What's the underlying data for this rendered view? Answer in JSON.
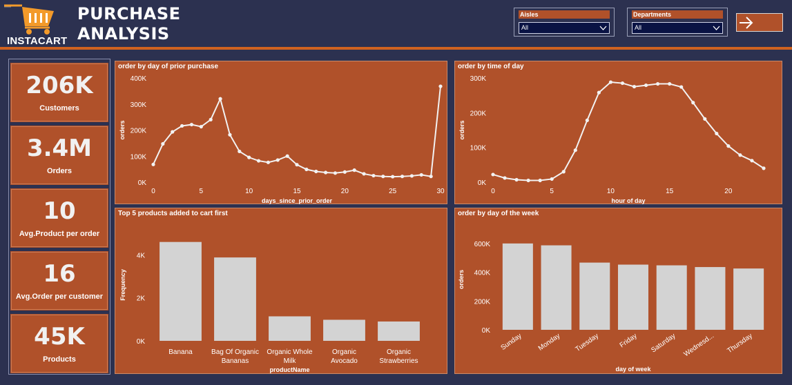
{
  "header": {
    "logo_text": "INSTACART",
    "title_line1": "PURCHASE",
    "title_line2": "ANALYSIS",
    "accent_color": "#d0621f",
    "icons": [
      "cart-icon",
      "arrow-right-icon",
      "chevron-down-icon"
    ]
  },
  "slicers": {
    "aisles": {
      "label": "Aisles",
      "value": "All"
    },
    "departments": {
      "label": "Departments",
      "value": "All"
    }
  },
  "kpis": [
    {
      "value": "206K",
      "label": "Customers"
    },
    {
      "value": "3.4M",
      "label": "Orders"
    },
    {
      "value": "10",
      "label": "Avg.Product per order"
    },
    {
      "value": "16",
      "label": "Avg.Order per customer"
    },
    {
      "value": "45K",
      "label": "Products"
    }
  ],
  "chart_data": [
    {
      "type": "line",
      "title": "order by day of prior purchase",
      "xlabel": "days_since_prior_order",
      "ylabel": "orders",
      "x": [
        0,
        1,
        2,
        3,
        4,
        5,
        6,
        7,
        8,
        9,
        10,
        11,
        12,
        13,
        14,
        15,
        16,
        17,
        18,
        19,
        20,
        21,
        22,
        23,
        24,
        25,
        26,
        27,
        28,
        29,
        30
      ],
      "values": [
        68000,
        147000,
        193000,
        216000,
        221000,
        213000,
        240000,
        320000,
        182000,
        118000,
        95000,
        82000,
        76000,
        85000,
        100000,
        67000,
        49000,
        41000,
        37000,
        35000,
        39000,
        46000,
        32000,
        25000,
        22000,
        21000,
        22000,
        24000,
        28000,
        22000,
        368000
      ],
      "xticks": [
        "0",
        "5",
        "10",
        "15",
        "20",
        "25",
        "30"
      ],
      "yticks": [
        "0K",
        "100K",
        "200K",
        "300K",
        "400K"
      ],
      "ylim": [
        0,
        400000
      ]
    },
    {
      "type": "line",
      "title": "order by time of day",
      "xlabel": "hour of day",
      "ylabel": "orders",
      "x": [
        0,
        1,
        2,
        3,
        4,
        5,
        6,
        7,
        8,
        9,
        10,
        11,
        12,
        13,
        14,
        15,
        16,
        17,
        18,
        19,
        20,
        21,
        22,
        23
      ],
      "values": [
        22000,
        12000,
        7000,
        5000,
        5000,
        9000,
        30000,
        92000,
        178000,
        258000,
        288000,
        285000,
        275000,
        279000,
        283000,
        283000,
        274000,
        229000,
        182000,
        140000,
        104000,
        78000,
        62000,
        40000
      ],
      "xticks": [
        "0",
        "5",
        "10",
        "15",
        "20"
      ],
      "yticks": [
        "0K",
        "100K",
        "200K",
        "300K"
      ],
      "ylim": [
        0,
        300000
      ]
    },
    {
      "type": "bar",
      "title": "Top 5 products added to cart first",
      "xlabel": "productName",
      "ylabel": "Frequency",
      "categories": [
        "Banana",
        "Bag Of Organic Bananas",
        "Organic Whole Milk",
        "Organic Avocado",
        "Organic Strawberries"
      ],
      "category_lines": [
        [
          "Banana"
        ],
        [
          "Bag Of Organic",
          "Bananas"
        ],
        [
          "Organic Whole",
          "Milk"
        ],
        [
          "Organic",
          "Avocado"
        ],
        [
          "Organic",
          "Strawberries"
        ]
      ],
      "values": [
        4600,
        3880,
        1140,
        980,
        900
      ],
      "yticks": [
        "0K",
        "2K",
        "4K"
      ],
      "ylim": [
        0,
        5200
      ]
    },
    {
      "type": "bar",
      "title": "order by day of the week",
      "xlabel": "day of week",
      "ylabel": "orders",
      "categories": [
        "Sunday",
        "Monday",
        "Tuesday",
        "Friday",
        "Saturday",
        "Wednesd...",
        "Thursday"
      ],
      "values": [
        600000,
        587000,
        467000,
        453000,
        448000,
        436000,
        426000
      ],
      "yticks": [
        "0K",
        "200K",
        "400K",
        "600K"
      ],
      "ylim": [
        0,
        700000
      ]
    }
  ]
}
